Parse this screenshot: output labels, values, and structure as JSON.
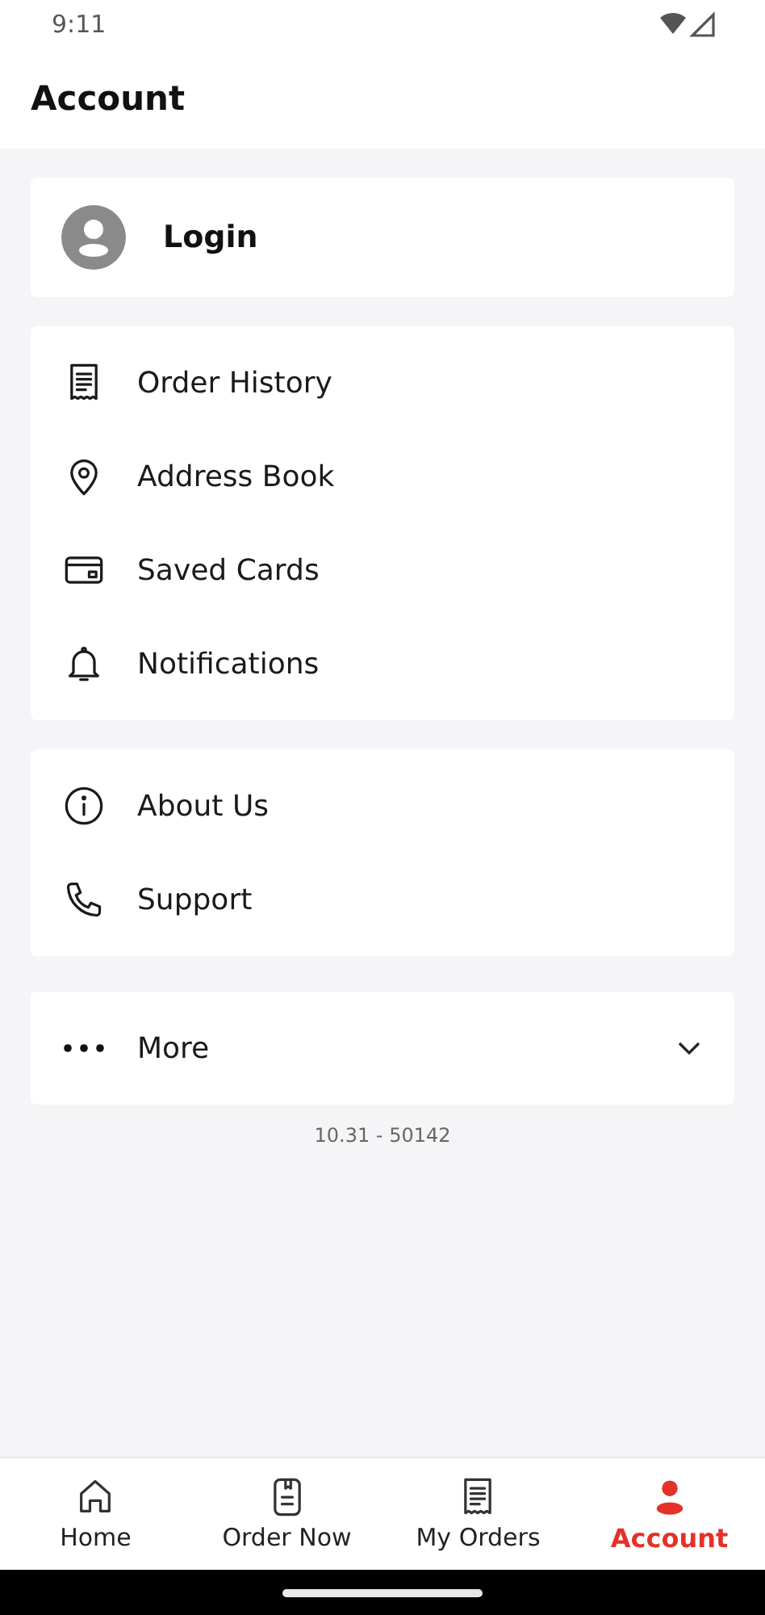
{
  "status_bar": {
    "time": "9:11"
  },
  "header": {
    "title": "Account"
  },
  "login": {
    "label": "Login"
  },
  "menu_groups": [
    {
      "items": [
        {
          "kind": "receipt",
          "label": "Order History"
        },
        {
          "kind": "pin",
          "label": "Address Book"
        },
        {
          "kind": "card",
          "label": "Saved Cards"
        },
        {
          "kind": "bell",
          "label": "Notifications"
        }
      ]
    },
    {
      "items": [
        {
          "kind": "info",
          "label": "About Us"
        },
        {
          "kind": "phone",
          "label": "Support"
        }
      ]
    }
  ],
  "more": {
    "label": "More",
    "expanded": false
  },
  "version": "10.31 - 50142",
  "bottom_nav": [
    {
      "kind": "home",
      "label": "Home",
      "selected": false
    },
    {
      "kind": "order",
      "label": "Order Now",
      "selected": false
    },
    {
      "kind": "receipt",
      "label": "My Orders",
      "selected": false
    },
    {
      "kind": "person",
      "label": "Account",
      "selected": true
    }
  ]
}
